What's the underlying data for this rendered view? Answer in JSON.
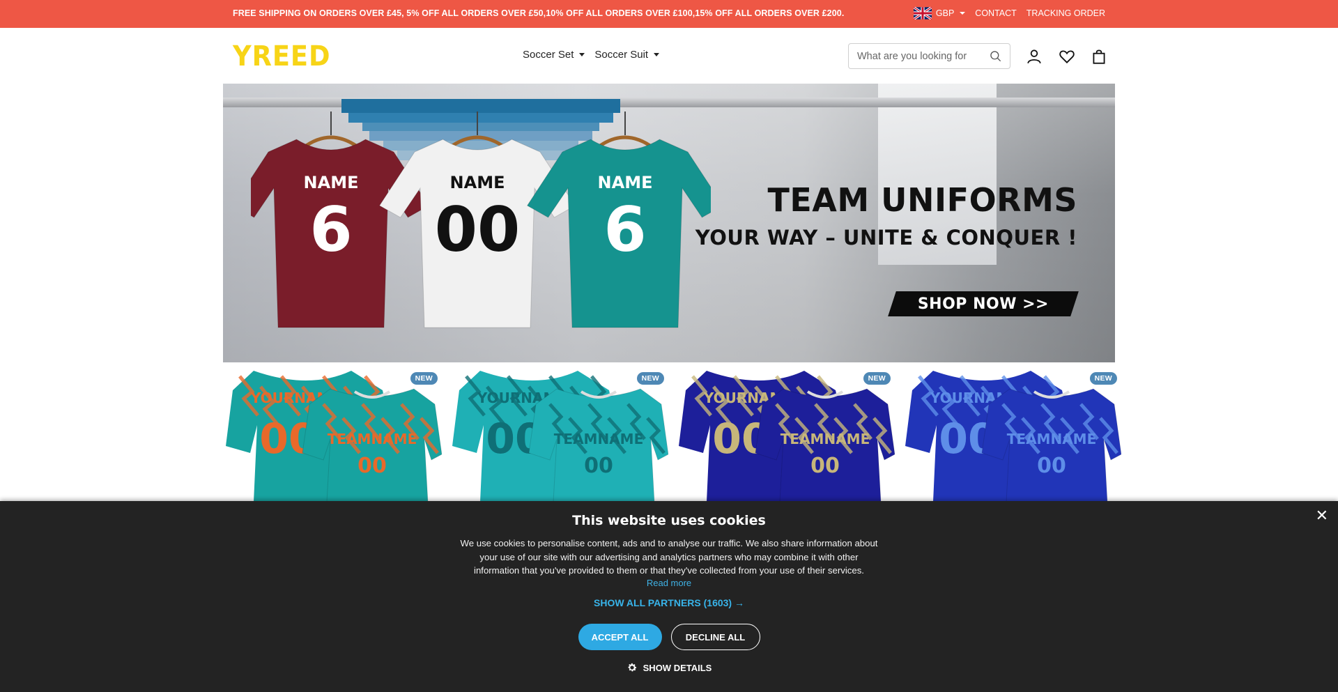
{
  "topbar": {
    "promo": "FREE SHIPPING ON ORDERS OVER £45, 5% OFF ALL ORDERS OVER £50,10% OFF ALL ORDERS OVER £100,15% OFF ALL ORDERS OVER £200.",
    "currency": "GBP",
    "contact": "CONTACT",
    "tracking": "TRACKING ORDER",
    "bg_color": "#ee5745"
  },
  "header": {
    "logo": "YREED",
    "logo_color": "#f7d417",
    "nav": [
      {
        "label": "Soccer Set"
      },
      {
        "label": "Soccer Suit"
      }
    ],
    "search_placeholder": "What are you looking for",
    "icons": [
      "account-icon",
      "wishlist-heart-icon",
      "cart-bag-icon"
    ]
  },
  "hero": {
    "title": "TEAM UNIFORMS",
    "subtitle": "YOUR WAY – UNITE & CONQUER !",
    "cta": "SHOP NOW >>",
    "jerseys": [
      {
        "name": "NAME",
        "number": "6",
        "color": "#7a1d2a"
      },
      {
        "name": "NAME",
        "number": "00",
        "color": "#f1f1f1"
      },
      {
        "name": "NAME",
        "number": "6",
        "color": "#15938f"
      }
    ]
  },
  "products": [
    {
      "badge": "NEW",
      "front_text": "YOURNAME",
      "back_text": "TEAMNAME",
      "number": "00",
      "base": "#17a3a0",
      "accent": "#e8692a"
    },
    {
      "badge": "NEW",
      "front_text": "YOURNAME",
      "back_text": "TEAMNAME",
      "number": "00",
      "base": "#1fb0b5",
      "accent": "#0f6f76"
    },
    {
      "badge": "NEW",
      "front_text": "YOURNAME",
      "back_text": "TEAMNAME",
      "number": "00",
      "base": "#1d1f9a",
      "accent": "#c7b67a"
    },
    {
      "badge": "NEW",
      "front_text": "YOURNAME",
      "back_text": "TEAMNAME",
      "number": "00",
      "base": "#2135b8",
      "accent": "#5e8ee8"
    }
  ],
  "cookie": {
    "title": "This website uses cookies",
    "body": "We use cookies to personalise content, ads and to analyse our traffic. We also share information about your use of our site with our advertising and analytics partners who may combine it with other information that you've provided to them or that they've collected from your use of their services.",
    "read_more": "Read more",
    "show_partners": "SHOW ALL PARTNERS (1603) →",
    "accept": "ACCEPT ALL",
    "decline": "DECLINE ALL",
    "details": "SHOW DETAILS",
    "accent_color": "#2ea9e3"
  }
}
